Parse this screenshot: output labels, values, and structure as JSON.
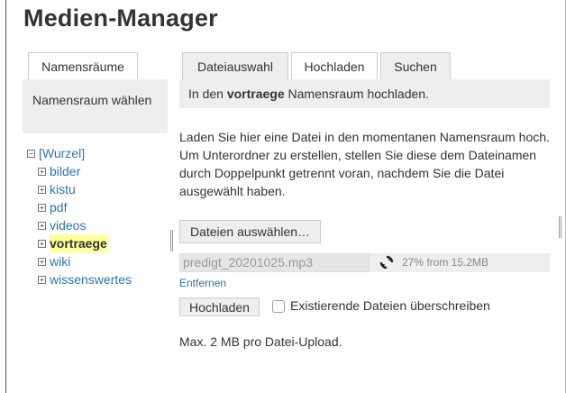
{
  "page": {
    "title": "Medien-Manager"
  },
  "left": {
    "tab_label": "Namensräume",
    "panel_text": "Namensraum wählen",
    "tree": {
      "root": "[Wurzel]",
      "items": [
        {
          "label": "bilder",
          "current": false
        },
        {
          "label": "kistu",
          "current": false
        },
        {
          "label": "pdf",
          "current": false
        },
        {
          "label": "videos",
          "current": false
        },
        {
          "label": "vortraege",
          "current": true
        },
        {
          "label": "wiki",
          "current": false
        },
        {
          "label": "wissenswertes",
          "current": false
        }
      ]
    }
  },
  "tabs": [
    {
      "label": "Dateiauswahl",
      "active": false
    },
    {
      "label": "Hochladen",
      "active": true
    },
    {
      "label": "Suchen",
      "active": false
    }
  ],
  "upload": {
    "info_prefix": "In den ",
    "namespace": "vortraege",
    "info_suffix": " Namensraum hochladen.",
    "description": "Laden Sie hier eine Datei in den momentanen Namensraum hoch. Um Unterordner zu erstellen, stellen Sie diese dem Dateinamen durch Doppelpunkt getrennt voran, nachdem Sie die Datei ausgewählt haben.",
    "select_button": "Dateien auswählen…",
    "file": {
      "name": "predigt_20201025.mp3",
      "progress": "27% from 15.2MB",
      "remove_label": "Entfernen"
    },
    "upload_button": "Hochladen",
    "overwrite_label": "Existierende Dateien überschreiben",
    "overwrite_checked": false,
    "max_size": "Max. 2 MB pro Datei-Upload."
  },
  "icons": {
    "tree_toggle": "plus-box-icon",
    "tree_root_toggle": "minus-box-icon",
    "spinner": "refresh-spinner-icon"
  }
}
